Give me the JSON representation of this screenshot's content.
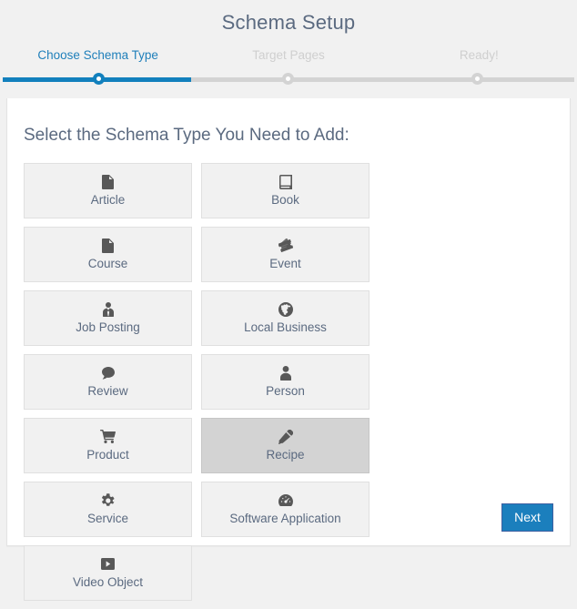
{
  "wizard": {
    "title": "Schema Setup",
    "steps": [
      {
        "label": "Choose Schema Type",
        "state": "active"
      },
      {
        "label": "Target Pages",
        "state": "inactive"
      },
      {
        "label": "Ready!",
        "state": "inactive"
      }
    ],
    "progress_percent": 33,
    "colors": {
      "active": "#1f7fba",
      "progress_fill": "#1280bd",
      "track": "#d3d3d3",
      "inactive_label": "#cfcfcf",
      "heading": "#5b6a80",
      "card_bg": "#f1f1f1",
      "card_selected_bg": "#d3d3d3",
      "button_bg": "#1b7fbd"
    }
  },
  "panel": {
    "heading": "Select the Schema Type You Need to Add:",
    "schema_types": [
      {
        "label": "Article",
        "icon": "file-icon",
        "selected": false
      },
      {
        "label": "Book",
        "icon": "book-icon",
        "selected": false
      },
      {
        "label": "Course",
        "icon": "file-icon",
        "selected": false
      },
      {
        "label": "Event",
        "icon": "tickets-icon",
        "selected": false
      },
      {
        "label": "Job Posting",
        "icon": "user-tie-icon",
        "selected": false
      },
      {
        "label": "Local Business",
        "icon": "globe-icon",
        "selected": false
      },
      {
        "label": "Review",
        "icon": "comment-icon",
        "selected": false
      },
      {
        "label": "Person",
        "icon": "user-icon",
        "selected": false
      },
      {
        "label": "Product",
        "icon": "shopping-cart-icon",
        "selected": false
      },
      {
        "label": "Recipe",
        "icon": "carrot-icon",
        "selected": true
      },
      {
        "label": "Service",
        "icon": "gear-icon",
        "selected": false
      },
      {
        "label": "Software Application",
        "icon": "tachometer-icon",
        "selected": false
      },
      {
        "label": "Video Object",
        "icon": "play-square-icon",
        "selected": false
      }
    ],
    "next_label": "Next"
  }
}
